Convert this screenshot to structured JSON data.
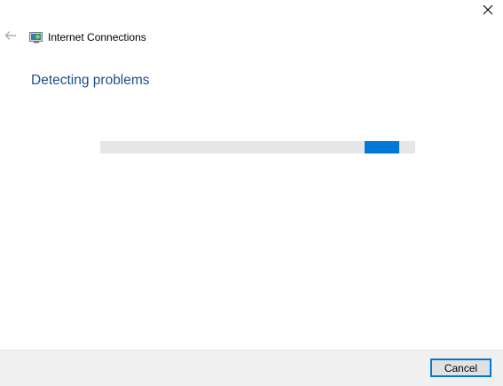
{
  "window": {
    "title": "Internet Connections",
    "close_icon": "close-icon",
    "back_icon": "back-arrow-icon",
    "app_icon": "network-troubleshooter-icon"
  },
  "main": {
    "heading": "Detecting problems",
    "progress": {
      "mode": "indeterminate",
      "accent_color": "#0078d7",
      "track_color": "#e6e6e6"
    }
  },
  "footer": {
    "cancel_label": "Cancel"
  },
  "colors": {
    "heading": "#1e4e8c",
    "footer_bg": "#f0f0f0",
    "accent": "#0078d7"
  }
}
